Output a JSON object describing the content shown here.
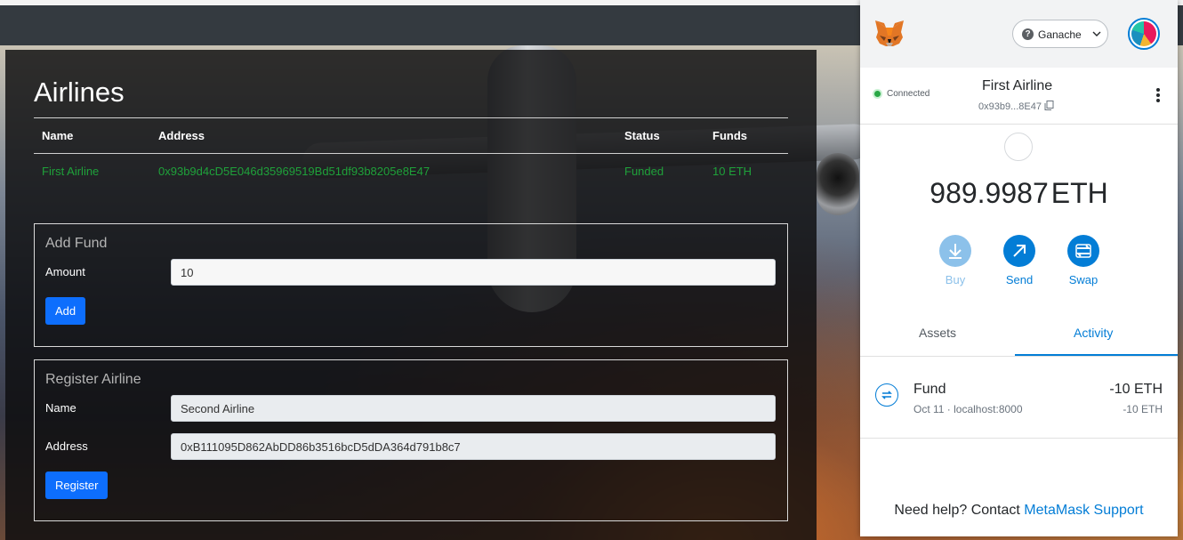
{
  "dapp": {
    "title": "Airlines",
    "table": {
      "headers": [
        "Name",
        "Address",
        "Status",
        "Funds"
      ],
      "rows": [
        {
          "name": "First Airline",
          "address": "0x93b9d4cD5E046d35969519Bd51df93b8205e8E47",
          "status": "Funded",
          "funds": "10 ETH"
        }
      ]
    },
    "add_fund": {
      "title": "Add Fund",
      "amount_label": "Amount",
      "amount_value": "10",
      "button": "Add"
    },
    "register_airline": {
      "title": "Register Airline",
      "name_label": "Name",
      "name_value": "Second Airline",
      "address_label": "Address",
      "address_value": "0xB111095D862AbDD86b3516bcD5dDA364d791b8c7",
      "button": "Register"
    }
  },
  "metamask": {
    "network": "Ganache",
    "connection_status": "Connected",
    "account_name": "First Airline",
    "account_address_short": "0x93b9...8E47",
    "balance": "989.9987",
    "balance_unit": "ETH",
    "actions": {
      "buy": "Buy",
      "send": "Send",
      "swap": "Swap"
    },
    "tabs": {
      "assets": "Assets",
      "activity": "Activity",
      "active": "Activity"
    },
    "transactions": [
      {
        "title": "Fund",
        "subtitle": "Oct 11 · localhost:8000",
        "amount": "-10 ETH",
        "amount_secondary": "-10 ETH"
      }
    ],
    "help": {
      "text": "Need help? Contact",
      "link": "MetaMask Support"
    },
    "colors": {
      "accent": "#037dd6",
      "buy_disabled": "#8cc1ea",
      "connected": "#28a745"
    }
  },
  "colors": {
    "table_text": "#1fa13a",
    "primary_button": "#0d6efd"
  }
}
